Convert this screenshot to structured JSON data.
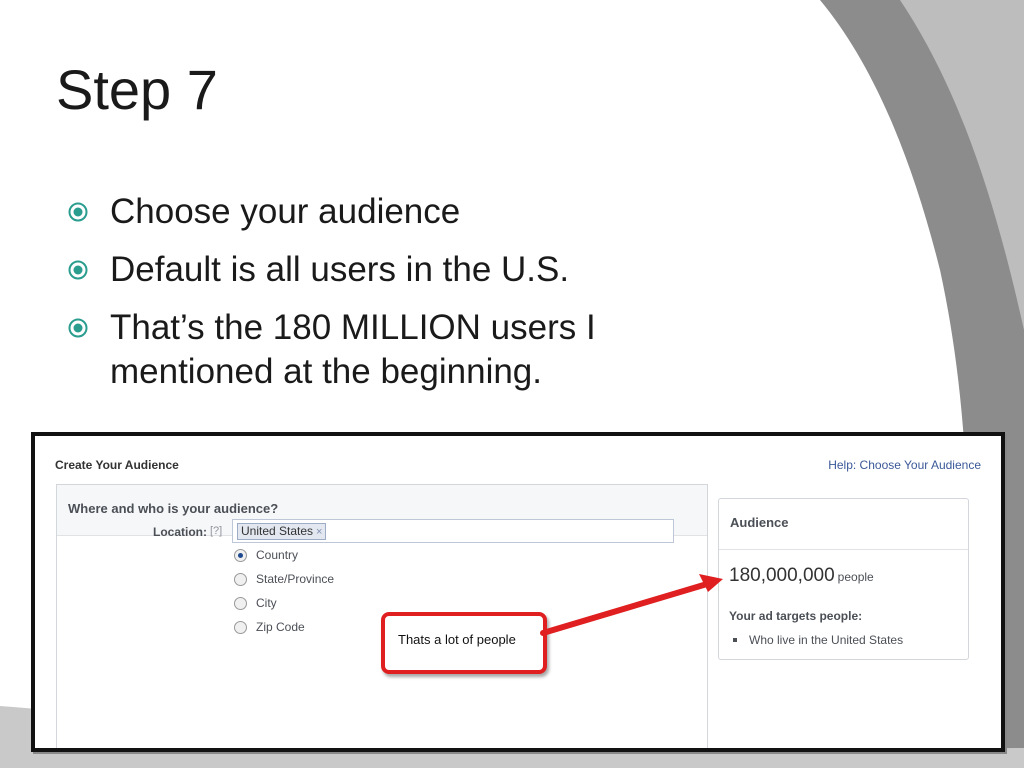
{
  "slide": {
    "title": "Step 7",
    "bullets": [
      "Choose your audience",
      "Default is all users in the U.S.",
      "That’s the 180 MILLION users I mentioned at the beginning."
    ],
    "colors": {
      "bullet": "#2a9d8f",
      "accent_red": "#e02020",
      "link_blue": "#3b5998"
    }
  },
  "screenshot": {
    "header": {
      "title": "Create Your Audience",
      "help_link": "Help: Choose Your Audience"
    },
    "form": {
      "section_title": "Where and who is your audience?",
      "location_label": "Location:",
      "location_help": "[?]",
      "location_token": "United States",
      "location_token_remove": "×",
      "location_type_options": [
        "Country",
        "State/Province",
        "City",
        "Zip Code"
      ],
      "location_type_selected": "Country"
    },
    "audience_panel": {
      "title": "Audience",
      "reach_count": "180,000,000",
      "reach_unit": "people",
      "targets_heading": "Your ad targets people:",
      "targets": [
        "Who live in the United States"
      ]
    },
    "callout": {
      "text": "Thats a lot of people"
    }
  }
}
